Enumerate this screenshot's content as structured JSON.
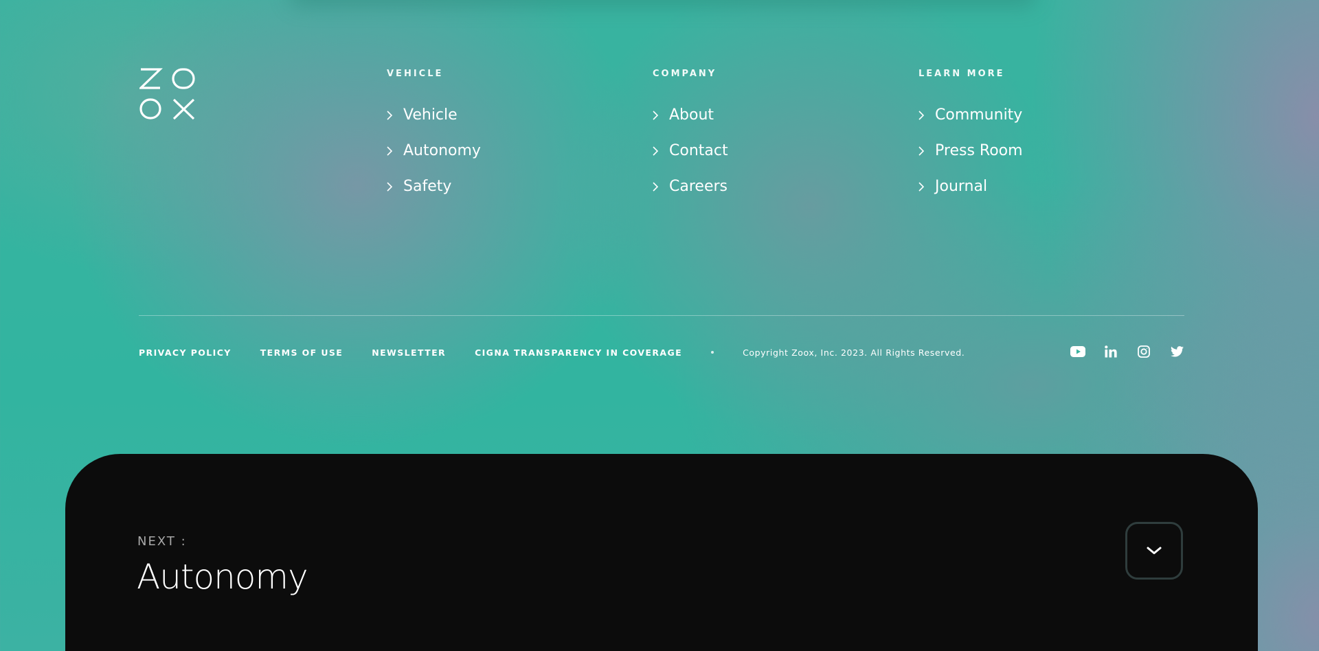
{
  "brand": {
    "logo_text": "ZOOX"
  },
  "footer": {
    "columns": [
      {
        "heading": "VEHICLE",
        "links": [
          "Vehicle",
          "Autonomy",
          "Safety"
        ]
      },
      {
        "heading": "COMPANY",
        "links": [
          "About",
          "Contact",
          "Careers"
        ]
      },
      {
        "heading": "LEARN MORE",
        "links": [
          "Community",
          "Press Room",
          "Journal"
        ]
      }
    ],
    "legal_links": [
      "PRIVACY POLICY",
      "TERMS OF USE",
      "NEWSLETTER",
      "CIGNA TRANSPARENCY IN COVERAGE"
    ],
    "copyright": "Copyright Zoox, Inc. 2023. All Rights Reserved.",
    "social": [
      "youtube-icon",
      "linkedin-icon",
      "instagram-icon",
      "twitter-icon"
    ]
  },
  "next": {
    "label": "NEXT :",
    "title": "Autonomy"
  },
  "colors": {
    "background": "#35b5a2",
    "panel": "#0c0c0c",
    "text": "#ffffff"
  }
}
